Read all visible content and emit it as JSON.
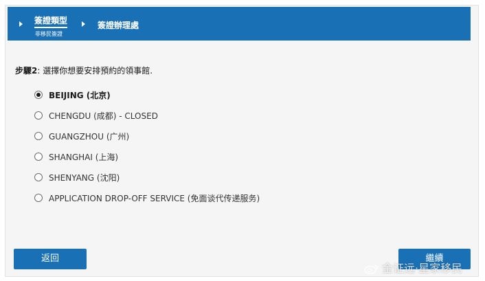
{
  "breadcrumb": {
    "step1": {
      "title": "簽證類型",
      "subtitle": "非移民簽證"
    },
    "step2": {
      "title": "簽證辦理處"
    }
  },
  "step": {
    "number": "步驟2",
    "text": ": 選擇你想要安排預約的領事館."
  },
  "options": [
    {
      "label": "BEIJING (北京)",
      "selected": true
    },
    {
      "label": "CHENGDU (成都) - CLOSED",
      "selected": false
    },
    {
      "label": "GUANGZHOU (广州)",
      "selected": false
    },
    {
      "label": "SHANGHAI (上海)",
      "selected": false
    },
    {
      "label": "SHENYANG (沈阳)",
      "selected": false
    },
    {
      "label": "APPLICATION DROP-OFF SERVICE (免面谈代传递服务)",
      "selected": false
    }
  ],
  "buttons": {
    "back": "返回",
    "next": "繼續"
  },
  "watermark": {
    "text": "金证远·星家移民",
    "icon": "weibo-icon"
  },
  "colors": {
    "accent": "#1a70b5"
  }
}
